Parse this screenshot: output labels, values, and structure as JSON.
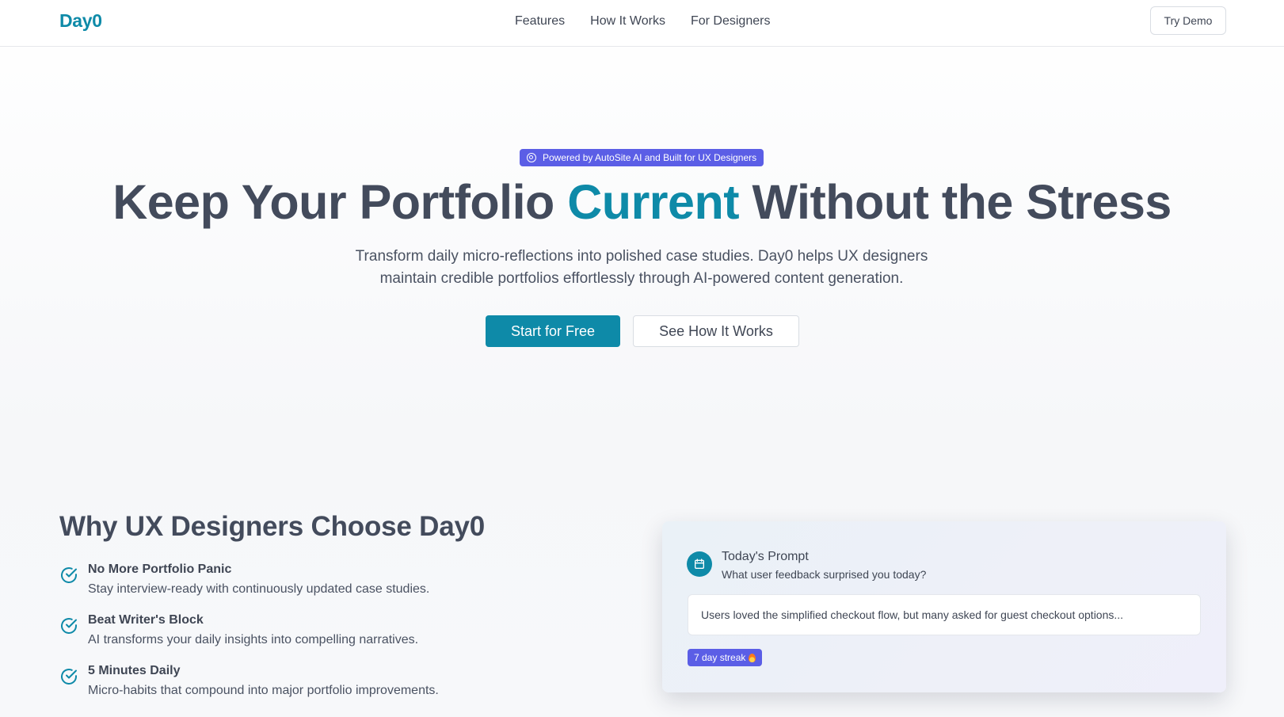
{
  "nav": {
    "logo": "Day0",
    "links": [
      "Features",
      "How It Works",
      "For Designers"
    ],
    "cta": "Try Demo"
  },
  "hero": {
    "badge": "Powered by AutoSite AI and Built for UX Designers",
    "badge_icon": "target-icon",
    "headline_part1": "Keep Your Portfolio ",
    "headline_accent": "Current",
    "headline_part2": " Without the Stress",
    "subhead_line1": "Transform daily micro-reflections into polished case studies. Day0 helps UX designers",
    "subhead_line2": "maintain credible portfolios effortlessly through AI-powered content generation.",
    "primary_button": "Start for Free",
    "secondary_button": "See How It Works"
  },
  "why": {
    "title": "Why UX Designers Choose Day0",
    "benefits": [
      {
        "title": "No More Portfolio Panic",
        "desc": "Stay interview-ready with continuously updated case studies.",
        "icon": "check-circle-icon"
      },
      {
        "title": "Beat Writer's Block",
        "desc": "AI transforms your daily insights into compelling narratives.",
        "icon": "check-circle-icon"
      },
      {
        "title": "5 Minutes Daily",
        "desc": "Micro-habits that compound into major portfolio improvements.",
        "icon": "check-circle-icon"
      }
    ]
  },
  "card": {
    "icon": "calendar-icon",
    "title": "Today's Prompt",
    "question": "What user feedback surprised you today?",
    "response": "Users loved the simplified checkout flow, but many asked for guest checkout options...",
    "streak": "7 day streak",
    "streak_icon": "flame-icon"
  },
  "colors": {
    "brand": "#0e8aa8",
    "badge": "#5b5ee6",
    "heading": "#434b5c"
  }
}
